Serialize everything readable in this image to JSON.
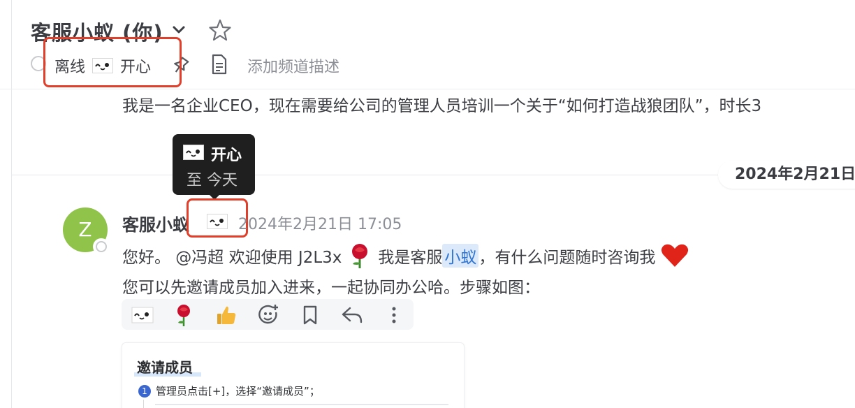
{
  "header": {
    "title": "客服小蚁 (你)",
    "status_label": "离线",
    "status_text": "开心",
    "description_placeholder": "添加频道描述"
  },
  "previous_message": "我是一名企业CEO，现在需要给公司的管理人员培训一个关于“如何打造战狼团队”，时长3",
  "date_divider": "2024年2月21日",
  "tooltip": {
    "status_text": "开心",
    "until": "至 今天"
  },
  "message": {
    "avatar_letter": "Z",
    "sender": "客服小蚁",
    "timestamp": "2024年2月21日 17:05",
    "line1_start": "您好。 @冯超 欢迎使用 J2L3x",
    "line1_mid": "我是客服",
    "line1_highlight": "小蚁",
    "line1_end": "，有什么问题随时咨询我",
    "line2": "您可以先邀请成员加入进来，一起协同办公哈。步骤如图："
  },
  "image_card": {
    "title": "邀请成员",
    "step_number": "1",
    "step_text": "管理员点击[+]，选择“邀请成员”；"
  },
  "colors": {
    "accent_red": "#e0402b",
    "avatar_green": "#8fc34a",
    "mention_blue": "#2f74d0"
  }
}
